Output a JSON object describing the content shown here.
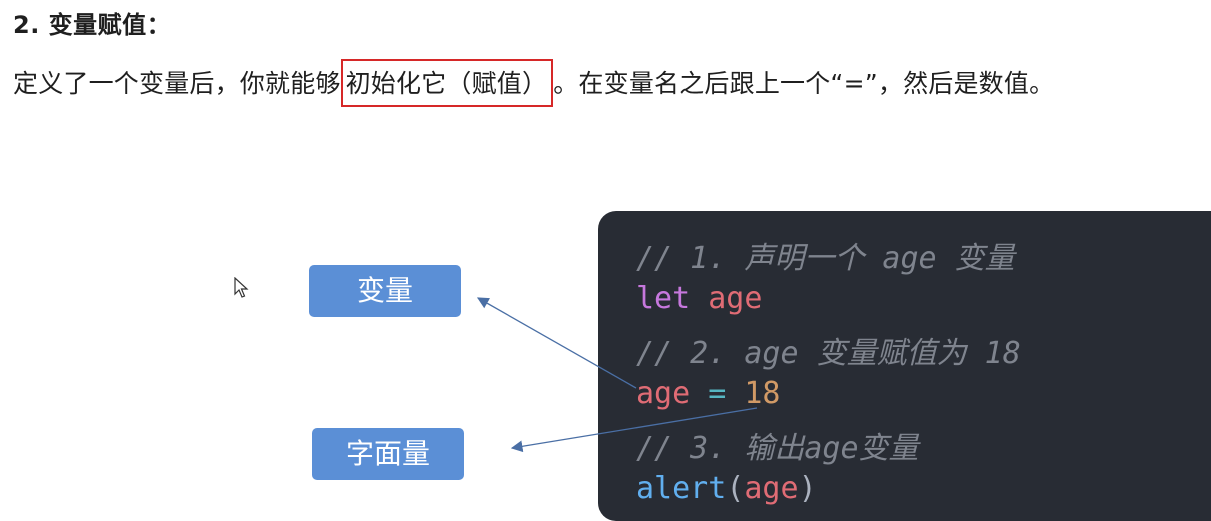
{
  "heading": "2. 变量赋值：",
  "paragraph": {
    "before": "定义了一个变量后，你就能够",
    "highlighted": "初始化它（赋值）",
    "after": "。在变量名之后跟上一个“=”，然后是数值。"
  },
  "code": {
    "line1": "// 1. 声明一个 age 变量",
    "line2_kw": "let",
    "line2_var": "age",
    "line3": "// 2. age 变量赋值为 18",
    "line4_var": "age",
    "line4_op": "=",
    "line4_num": "18",
    "line5": "// 3. 输出age变量",
    "line6_fn": "alert",
    "line6_open": "(",
    "line6_arg": "age",
    "line6_close": ")"
  },
  "labels": {
    "variable": "变量",
    "literal": "字面量"
  },
  "colors": {
    "highlight_border": "#d62828",
    "label_bg": "#5b8fd6",
    "code_bg": "#282c34",
    "arrow": "#4a6fa5"
  }
}
